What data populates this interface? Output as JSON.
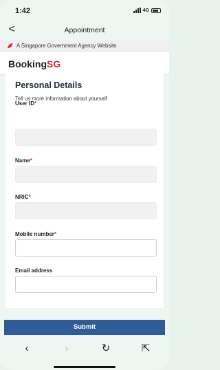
{
  "status_bar": {
    "time": "1:42",
    "network": "4G"
  },
  "nav": {
    "back_glyph": "<",
    "title": "Appointment"
  },
  "gov_banner": {
    "icon": "lion-head-icon",
    "text": "A Singapore Government Agency Website"
  },
  "brand": {
    "name_main": "Booking",
    "name_accent": "SG",
    "accent_color": "#d0312d"
  },
  "form": {
    "title": "Personal Details",
    "subtitle": "Tell us more information about yourself",
    "required_mark": "*",
    "fields": [
      {
        "label": "User ID",
        "required": true,
        "value": "",
        "readonly": true
      },
      {
        "label": "Name",
        "required": true,
        "value": "",
        "readonly": true
      },
      {
        "label": "NRIC",
        "required": true,
        "value": "",
        "readonly": true
      },
      {
        "label": "Mobile number",
        "required": true,
        "value": "",
        "readonly": false
      },
      {
        "label": "Email address",
        "required": false,
        "value": "",
        "readonly": false
      }
    ]
  },
  "submit": {
    "label": "Submit",
    "color": "#2f5b98"
  },
  "toolbar": {
    "back": "‹",
    "forward": "›",
    "reload": "↻",
    "share": "⇱"
  }
}
